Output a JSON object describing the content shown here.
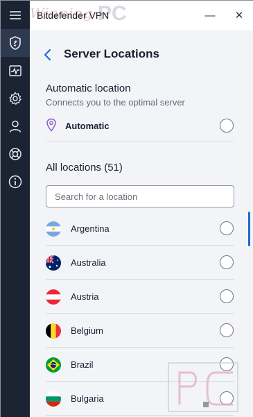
{
  "app": {
    "title": "Bitdefender VPN"
  },
  "watermark": {
    "script": "Winning",
    "pc": "PC"
  },
  "window_controls": {
    "minimize": "—",
    "close": "✕"
  },
  "sidebar": {
    "items": [
      {
        "icon": "menu-icon",
        "active": false
      },
      {
        "icon": "shield-link-icon",
        "active": true
      },
      {
        "icon": "activity-icon",
        "active": false
      },
      {
        "icon": "settings-icon",
        "active": false
      },
      {
        "icon": "account-icon",
        "active": false
      },
      {
        "icon": "support-icon",
        "active": false
      },
      {
        "icon": "info-icon",
        "active": false
      }
    ]
  },
  "page": {
    "title": "Server Locations"
  },
  "automatic": {
    "title": "Automatic location",
    "subtitle": "Connects you to the optimal server",
    "label": "Automatic"
  },
  "all_locations": {
    "title": "All locations (51)",
    "search_placeholder": "Search for a location",
    "countries": [
      {
        "name": "Argentina",
        "flag": "argentina-flag-icon"
      },
      {
        "name": "Australia",
        "flag": "australia-flag-icon"
      },
      {
        "name": "Austria",
        "flag": "austria-flag-icon"
      },
      {
        "name": "Belgium",
        "flag": "belgium-flag-icon"
      },
      {
        "name": "Brazil",
        "flag": "brazil-flag-icon"
      },
      {
        "name": "Bulgaria",
        "flag": "bulgaria-flag-icon"
      }
    ]
  },
  "colors": {
    "accent": "#1f6ad4",
    "sidebar": "#1c2433",
    "pin": "#8c58c7"
  }
}
